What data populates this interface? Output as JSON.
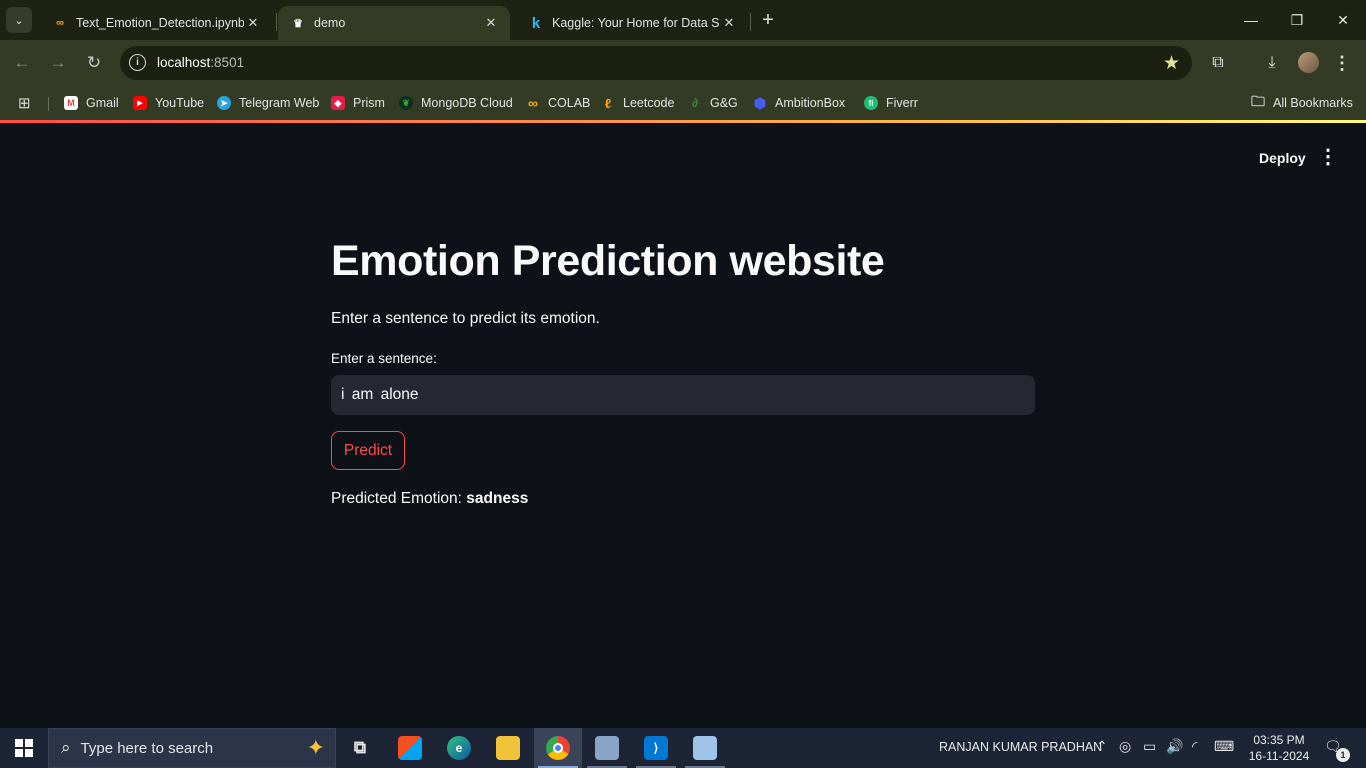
{
  "browser": {
    "tabs": [
      {
        "title": "Text_Emotion_Detection.ipynb -",
        "favicon": "colab-icon"
      },
      {
        "title": "demo",
        "favicon": "streamlit-icon",
        "active": true
      },
      {
        "title": "Kaggle: Your Home for Data Sci",
        "favicon": "kaggle-icon"
      }
    ],
    "close_glyph": "✕",
    "new_tab_glyph": "+",
    "url_host": "localhost",
    "url_port": ":8501",
    "bookmarks": [
      {
        "label": "Gmail",
        "icon": "gmail-icon",
        "glyph": "M"
      },
      {
        "label": "YouTube",
        "icon": "youtube-icon",
        "glyph": "▶"
      },
      {
        "label": "Telegram Web",
        "icon": "telegram-icon",
        "glyph": "➤"
      },
      {
        "label": "Prism",
        "icon": "prism-icon",
        "glyph": "◆"
      },
      {
        "label": "MongoDB Cloud",
        "icon": "mongodb-icon",
        "glyph": "❦"
      },
      {
        "label": "COLAB",
        "icon": "colab-icon",
        "glyph": "∞"
      },
      {
        "label": "Leetcode",
        "icon": "leetcode-icon",
        "glyph": "ℓ"
      },
      {
        "label": "G&G",
        "icon": "geeksforgeeks-icon",
        "glyph": "∂"
      },
      {
        "label": "AmbitionBox",
        "icon": "ambitionbox-icon",
        "glyph": "⬢"
      },
      {
        "label": "Fiverr",
        "icon": "fiverr-icon",
        "glyph": "fi"
      }
    ],
    "all_bookmarks": "All Bookmarks"
  },
  "app": {
    "deploy_label": "Deploy",
    "title": "Emotion Prediction website",
    "subtitle": "Enter a sentence to predict its emotion.",
    "input_label": "Enter a sentence:",
    "input_value": "i am alone",
    "button_label": "Predict",
    "result_prefix": "Predicted Emotion:",
    "result_value": "sadness"
  },
  "taskbar": {
    "search_placeholder": "Type here to search",
    "user_name": "RANJAN KUMAR PRADHAN",
    "time": "03:35 PM",
    "date": "16-11-2024",
    "notification_count": "1"
  },
  "colors": {
    "accent": "#ff4b4b",
    "app_background": "#0e1117",
    "input_background": "#262730"
  }
}
